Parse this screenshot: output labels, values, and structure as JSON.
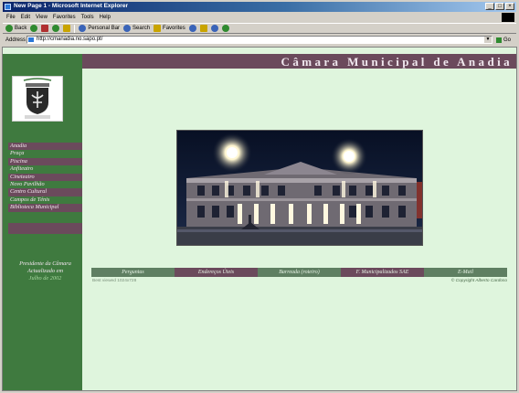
{
  "window": {
    "title": "New Page 1 - Microsoft Internet Explorer",
    "controls": [
      "_",
      "□",
      "×"
    ]
  },
  "menu": [
    "File",
    "Edit",
    "View",
    "Favorites",
    "Tools",
    "Help"
  ],
  "toolbar": {
    "back": "Back",
    "personal_bar": "Personal Bar",
    "search": "Search",
    "favorites": "Favorites"
  },
  "address": {
    "label": "Address",
    "url": "http://cmanadia.no.sapo.pt/",
    "go": "Go"
  },
  "site": {
    "title": "Câmara Municipal de Anadia",
    "nav": [
      "Anadia",
      "Praça",
      "Piscina",
      "Anfiteatro",
      "Cineteatro",
      "Novo Pavilhão",
      "Centro Cultural",
      "Campos de Ténis",
      "Biblioteca Municipal"
    ],
    "president": "Presidente da Câmara",
    "updated": "Actualizado em",
    "updated_date": "Julho de 2002",
    "bottom_nav": [
      "Perguntas",
      "Endereços Úteis",
      "Barreada (roteiro)",
      "F. Municipalizados SAE",
      "E-Mail"
    ],
    "best_viewed": "Best viewed 1024x728",
    "copyright": "© Copyright Alberto Cardoso"
  },
  "colors": {
    "green": "#3f7a3f",
    "purple": "#6b4a5c",
    "page_bg": "#dff5dd"
  }
}
